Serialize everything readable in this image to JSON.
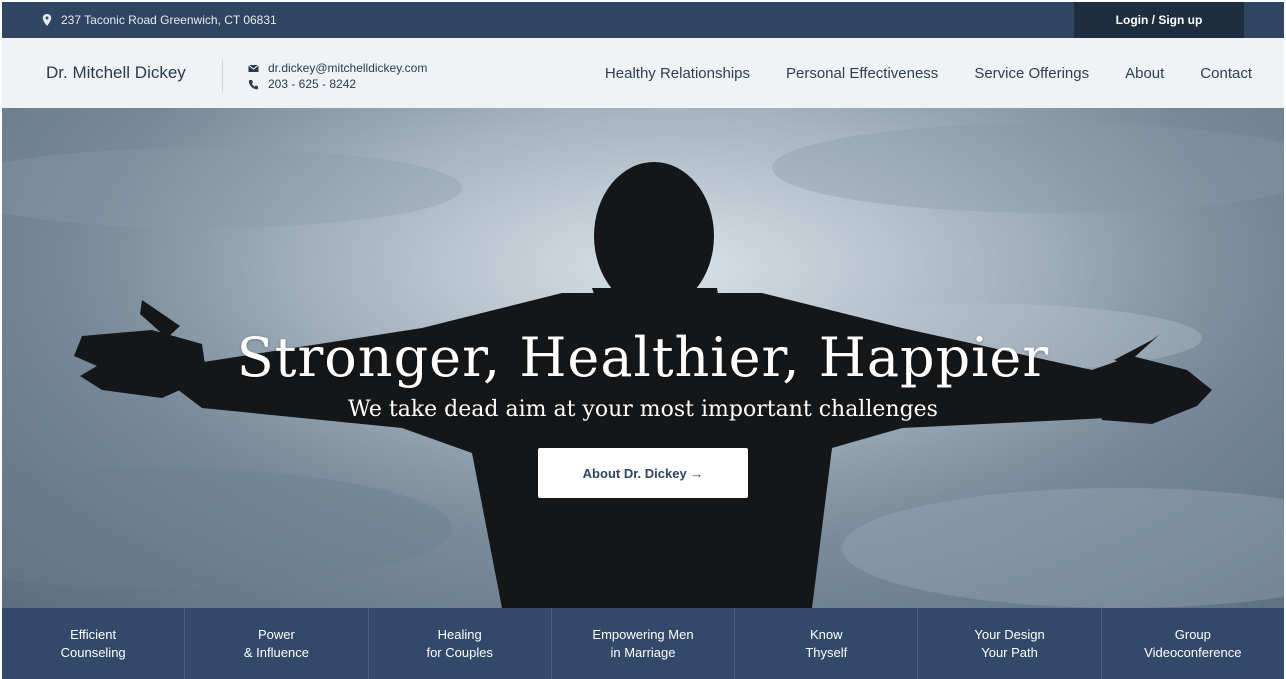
{
  "topbar": {
    "address": "237 Taconic Road Greenwich, CT 06831",
    "login_label": "Login / Sign up"
  },
  "header": {
    "brand": "Dr. Mitchell Dickey",
    "email": "dr.dickey@mitchelldickey.com",
    "phone": "203 - 625 - 8242"
  },
  "nav": {
    "items": [
      {
        "label": "Healthy Relationships"
      },
      {
        "label": "Personal Effectiveness"
      },
      {
        "label": "Service Offerings"
      },
      {
        "label": "About"
      },
      {
        "label": "Contact"
      }
    ]
  },
  "hero": {
    "title": "Stronger, Healthier, Happier",
    "subtitle": "We take dead aim at your most important challenges",
    "cta_label": "About Dr. Dickey →"
  },
  "tiles": [
    {
      "line1": "Efficient",
      "line2": "Counseling"
    },
    {
      "line1": "Power",
      "line2": "& Influence"
    },
    {
      "line1": "Healing",
      "line2": "for Couples"
    },
    {
      "line1": "Empowering Men",
      "line2": "in Marriage"
    },
    {
      "line1": "Know",
      "line2": "Thyself"
    },
    {
      "line1": "Your Design",
      "line2": "Your Path"
    },
    {
      "line1": "Group",
      "line2": "Videoconference"
    }
  ],
  "icons": {
    "address": "map-pin-icon",
    "email": "envelope-icon",
    "phone": "phone-icon"
  },
  "colors": {
    "topbar": "#2f4562",
    "login_bg": "#1e2d40",
    "navbar": "#eff3f6",
    "tiles": "#33496a"
  }
}
